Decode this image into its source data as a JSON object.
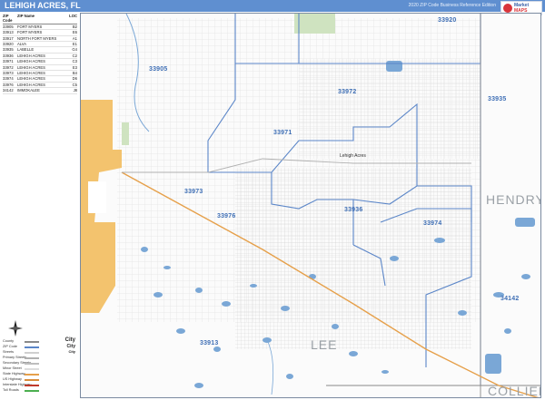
{
  "header": {
    "title": "LEHIGH ACRES, FL",
    "edition": "2020 ZIP Code Business Reference Edition",
    "logo_line1": "Market",
    "logo_line2": "MAPS"
  },
  "zip_table": {
    "headers": [
      "ZIP Code",
      "ZIP Name",
      "LOC"
    ],
    "rows": [
      [
        "33905",
        "FORT MYERS",
        "B2"
      ],
      [
        "33913",
        "FORT MYERS",
        "E6"
      ],
      [
        "33917",
        "NORTH FORT MYERS",
        "A1"
      ],
      [
        "33920",
        "ALVA",
        "E1"
      ],
      [
        "33935",
        "LABELLE",
        "G4"
      ],
      [
        "33936",
        "LEHIGH ACRES",
        "C2"
      ],
      [
        "33971",
        "LEHIGH ACRES",
        "C3"
      ],
      [
        "33972",
        "LEHIGH ACRES",
        "E3"
      ],
      [
        "33973",
        "LEHIGH ACRES",
        "B4"
      ],
      [
        "33974",
        "LEHIGH ACRES",
        "D6"
      ],
      [
        "33976",
        "LEHIGH ACRES",
        "C5"
      ],
      [
        "34142",
        "IMMOKALEE",
        "J8"
      ]
    ]
  },
  "map": {
    "zip_labels": [
      "33920",
      "33905",
      "33972",
      "33935",
      "33971",
      "33973",
      "33976",
      "33936",
      "33974",
      "34142",
      "33913"
    ],
    "county_labels": [
      "HENDRY",
      "LEE",
      "COLLIER"
    ],
    "place_label": "Lehigh Acres",
    "colors": {
      "zip_boundary": "#5b86c8",
      "water": "#7aa7d6",
      "city_fill": "#f2c066",
      "road": "#c9c9c9",
      "highway": "#e6a04a"
    }
  },
  "legend": {
    "items": [
      "County",
      "ZIP Code",
      "Streets",
      "Primary Streets",
      "Secondary Streets",
      "Minor Street",
      "State Highway",
      "US Highway",
      "Interstate Highway",
      "Toll Roads"
    ],
    "city_labels": [
      "City",
      "City",
      "City"
    ]
  }
}
